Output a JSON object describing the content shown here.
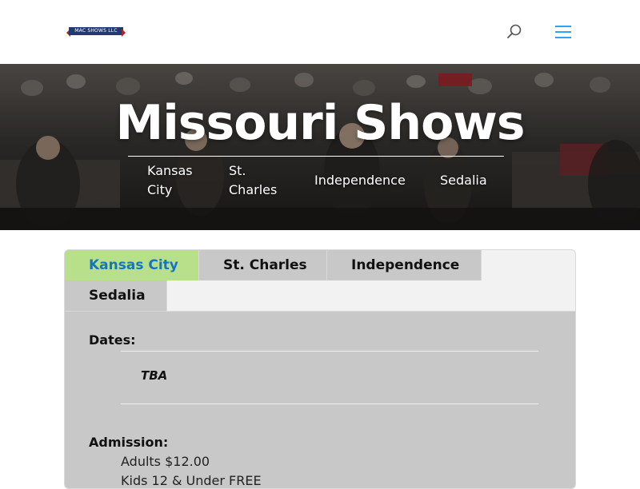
{
  "header": {
    "logo_text": "MAC SHOWS LLC",
    "icons": {
      "search": "search-icon",
      "menu": "hamburger-menu-icon"
    },
    "accent_color": "#2ea3f2"
  },
  "hero": {
    "title": "Missouri Shows",
    "links": [
      "Kansas City",
      "St. Charles",
      "Independence",
      "Sedalia"
    ]
  },
  "tabs": {
    "items": [
      "Kansas City",
      "St. Charles",
      "Independence",
      "Sedalia"
    ],
    "active_index": 0,
    "active_bg": "#b8e08a",
    "active_text_color": "#1474c8",
    "content": {
      "dates_label": "Dates:",
      "dates_value": "TBA",
      "admission_label": "Admission:",
      "admission_lines": [
        "Adults $12.00",
        "Kids 12 & Under FREE"
      ]
    }
  }
}
